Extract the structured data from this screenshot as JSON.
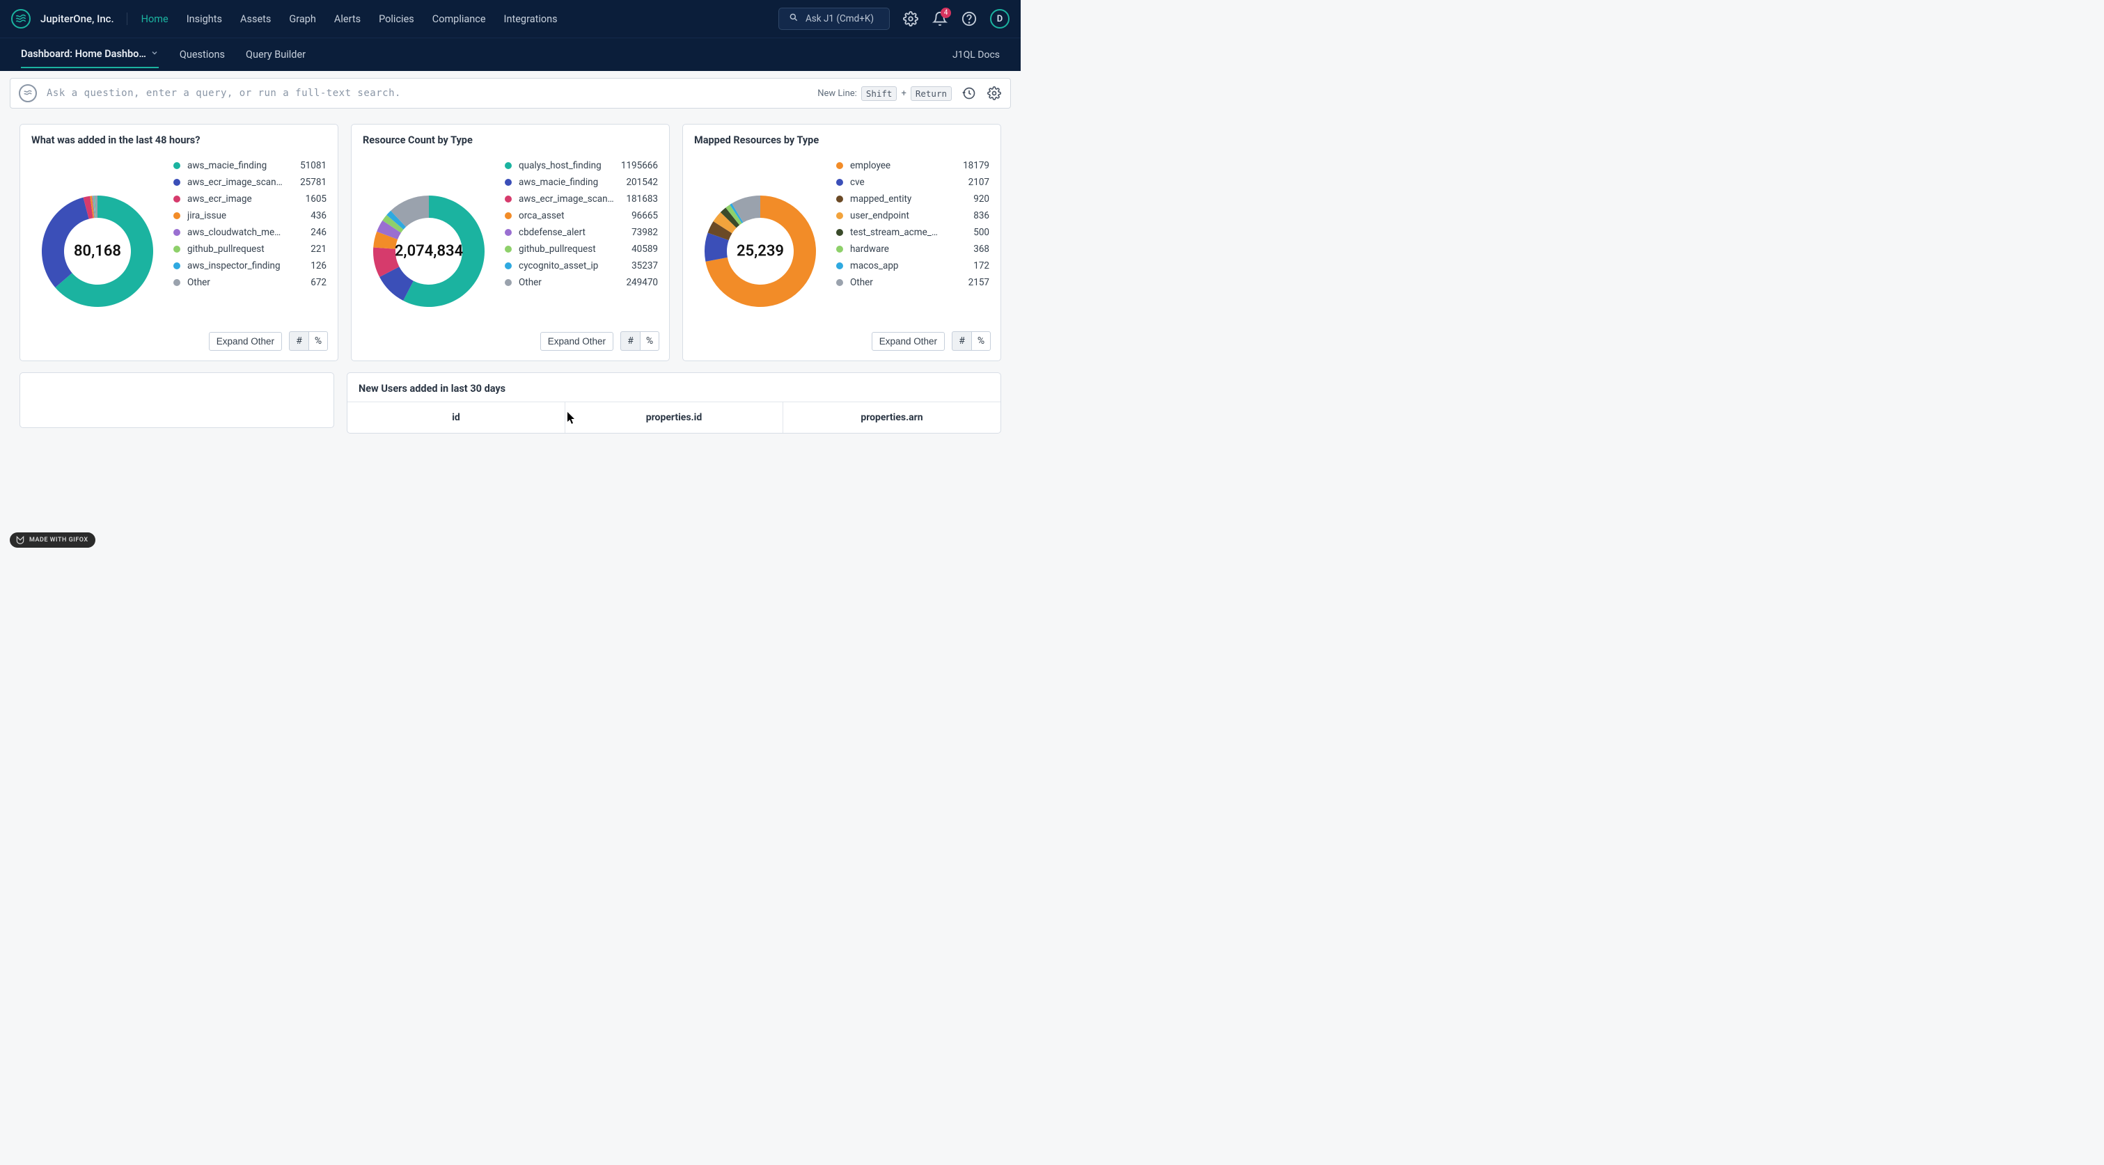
{
  "brand": "JupiterOne, Inc.",
  "nav": {
    "items": [
      "Home",
      "Insights",
      "Assets",
      "Graph",
      "Alerts",
      "Policies",
      "Compliance",
      "Integrations"
    ],
    "active": "Home"
  },
  "ask_j1": "Ask J1 (Cmd+K)",
  "notif_count": "4",
  "avatar_letter": "D",
  "subnav": {
    "dashboard_label": "Dashboard: Home Dashbo…",
    "tabs": [
      "Questions",
      "Query Builder"
    ],
    "docs": "J1QL Docs"
  },
  "search": {
    "placeholder": "Ask a question, enter a query, or run a full-text search.",
    "newline_label": "New Line:",
    "kbd1": "Shift",
    "plus": "+",
    "kbd2": "Return"
  },
  "expand_other_label": "Expand Other",
  "hash_label": "#",
  "pct_label": "%",
  "cards": [
    {
      "title": "What was added in the last 48 hours?",
      "total": "80,168",
      "legend": [
        {
          "name": "aws_macie_finding",
          "value": "51081",
          "color": "#1bb3a0"
        },
        {
          "name": "aws_ecr_image_scan…",
          "value": "25781",
          "color": "#3b4fb8"
        },
        {
          "name": "aws_ecr_image",
          "value": "1605",
          "color": "#d63b6c"
        },
        {
          "name": "jira_issue",
          "value": "436",
          "color": "#f28c28"
        },
        {
          "name": "aws_cloudwatch_me…",
          "value": "246",
          "color": "#9a6fd1"
        },
        {
          "name": "github_pullrequest",
          "value": "221",
          "color": "#8ed06a"
        },
        {
          "name": "aws_inspector_finding",
          "value": "126",
          "color": "#2fa9e0"
        },
        {
          "name": "Other",
          "value": "672",
          "color": "#9aa2ad"
        }
      ]
    },
    {
      "title": "Resource Count by Type",
      "total": "2,074,834",
      "legend": [
        {
          "name": "qualys_host_finding",
          "value": "1195666",
          "color": "#1bb3a0"
        },
        {
          "name": "aws_macie_finding",
          "value": "201542",
          "color": "#3b4fb8"
        },
        {
          "name": "aws_ecr_image_scan…",
          "value": "181683",
          "color": "#d63b6c"
        },
        {
          "name": "orca_asset",
          "value": "96665",
          "color": "#f28c28"
        },
        {
          "name": "cbdefense_alert",
          "value": "73982",
          "color": "#9a6fd1"
        },
        {
          "name": "github_pullrequest",
          "value": "40589",
          "color": "#8ed06a"
        },
        {
          "name": "cycognito_asset_ip",
          "value": "35237",
          "color": "#2fa9e0"
        },
        {
          "name": "Other",
          "value": "249470",
          "color": "#9aa2ad"
        }
      ]
    },
    {
      "title": "Mapped Resources by Type",
      "total": "25,239",
      "legend": [
        {
          "name": "employee",
          "value": "18179",
          "color": "#f28c28"
        },
        {
          "name": "cve",
          "value": "2107",
          "color": "#3b4fb8"
        },
        {
          "name": "mapped_entity",
          "value": "920",
          "color": "#6b4a26"
        },
        {
          "name": "user_endpoint",
          "value": "836",
          "color": "#f2a33c"
        },
        {
          "name": "test_stream_acme_…",
          "value": "500",
          "color": "#3a4a2a"
        },
        {
          "name": "hardware",
          "value": "368",
          "color": "#8ed06a"
        },
        {
          "name": "macos_app",
          "value": "172",
          "color": "#2fa9e0"
        },
        {
          "name": "Other",
          "value": "2157",
          "color": "#9aa2ad"
        }
      ]
    }
  ],
  "table": {
    "title": "New Users added in last 30 days",
    "columns": [
      "id",
      "properties.id",
      "properties.arn"
    ]
  },
  "gifox": "MADE WITH GIFOX",
  "chart_data": [
    {
      "type": "pie",
      "title": "What was added in the last 48 hours?",
      "series": [
        {
          "name": "count",
          "values": [
            51081,
            25781,
            1605,
            436,
            246,
            221,
            126,
            672
          ]
        }
      ],
      "categories": [
        "aws_macie_finding",
        "aws_ecr_image_scan…",
        "aws_ecr_image",
        "jira_issue",
        "aws_cloudwatch_me…",
        "github_pullrequest",
        "aws_inspector_finding",
        "Other"
      ],
      "total": 80168
    },
    {
      "type": "pie",
      "title": "Resource Count by Type",
      "series": [
        {
          "name": "count",
          "values": [
            1195666,
            201542,
            181683,
            96665,
            73982,
            40589,
            35237,
            249470
          ]
        }
      ],
      "categories": [
        "qualys_host_finding",
        "aws_macie_finding",
        "aws_ecr_image_scan…",
        "orca_asset",
        "cbdefense_alert",
        "github_pullrequest",
        "cycognito_asset_ip",
        "Other"
      ],
      "total": 2074834
    },
    {
      "type": "pie",
      "title": "Mapped Resources by Type",
      "series": [
        {
          "name": "count",
          "values": [
            18179,
            2107,
            920,
            836,
            500,
            368,
            172,
            2157
          ]
        }
      ],
      "categories": [
        "employee",
        "cve",
        "mapped_entity",
        "user_endpoint",
        "test_stream_acme_…",
        "hardware",
        "macos_app",
        "Other"
      ],
      "total": 25239
    }
  ]
}
